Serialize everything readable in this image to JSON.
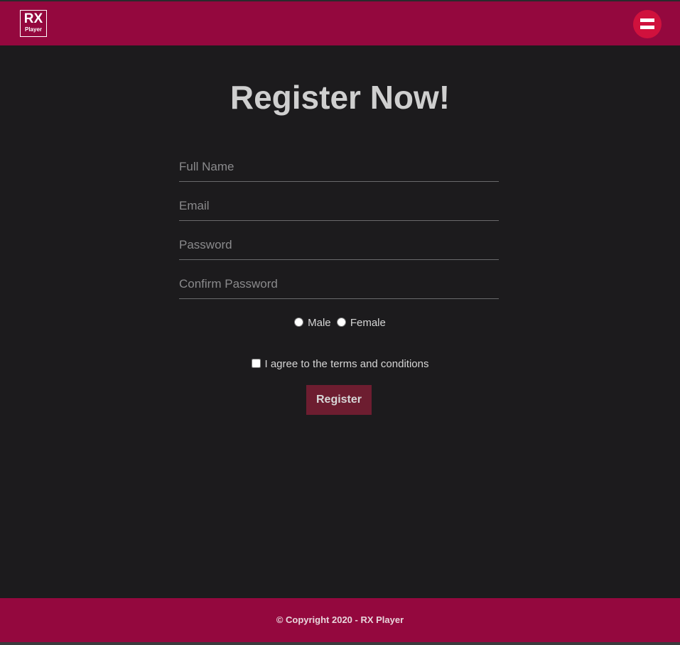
{
  "brand": {
    "logo_main": "RX",
    "logo_sub": "Player"
  },
  "header": {
    "menu_icon": "hamburger-icon"
  },
  "form": {
    "title": "Register Now!",
    "full_name_placeholder": "Full Name",
    "email_placeholder": "Email",
    "password_placeholder": "Password",
    "confirm_password_placeholder": "Confirm Password",
    "gender_options": [
      "Male",
      "Female"
    ],
    "terms_label": "I agree to the terms and conditions",
    "submit_label": "Register"
  },
  "footer": {
    "copyright": "© Copyright 2020 - RX Player"
  },
  "colors": {
    "header_bg": "#94083e",
    "page_bg": "#1c1b1d",
    "menu_button": "#d0113d",
    "register_button": "#6d1d30"
  }
}
